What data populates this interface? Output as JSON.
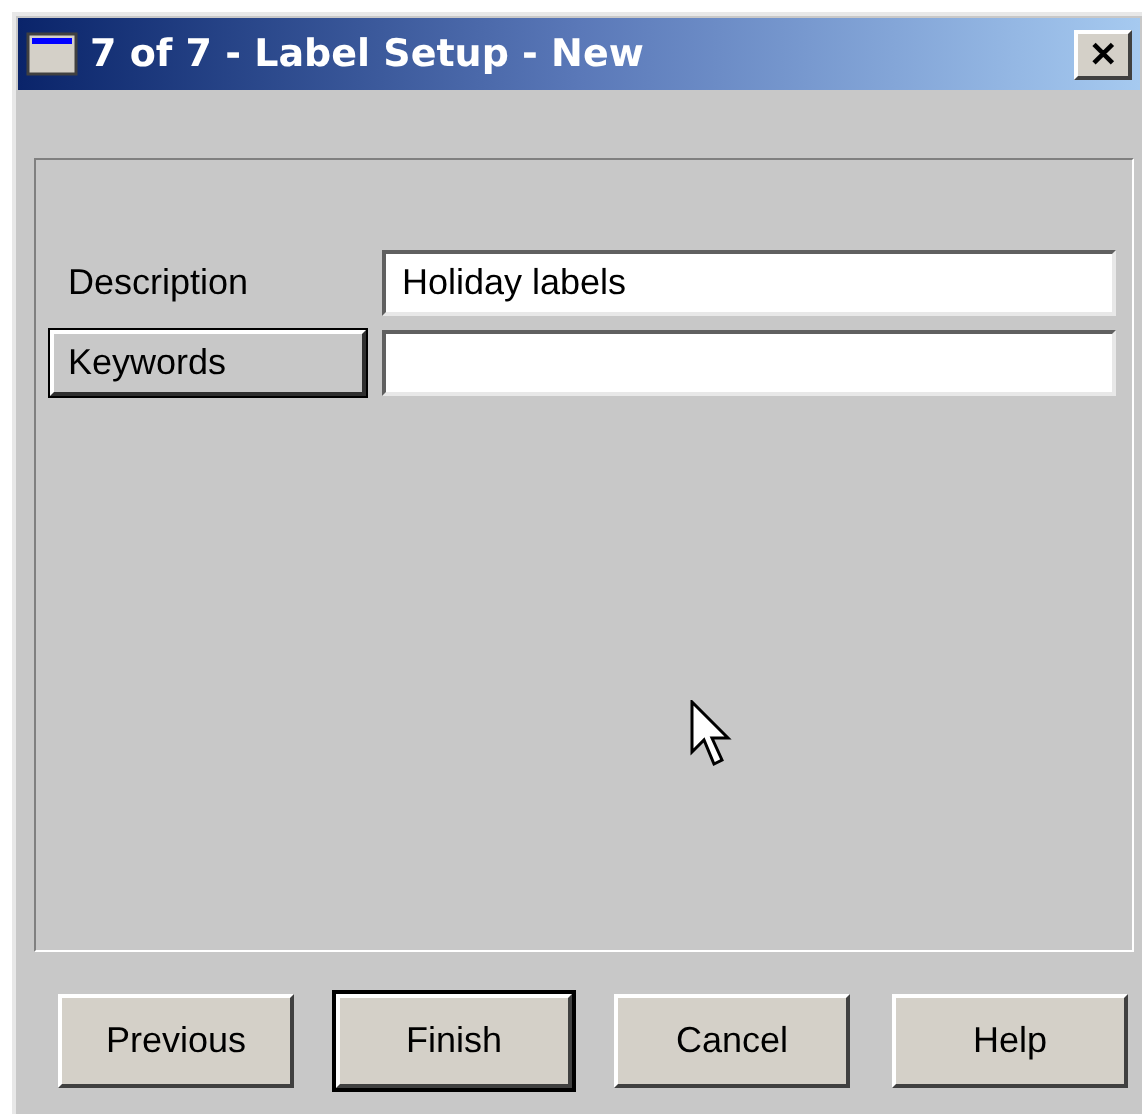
{
  "window": {
    "title": "7 of 7 - Label Setup - New",
    "close": "✕"
  },
  "fields": [
    {
      "kind": "label",
      "label": "Description",
      "value": "Holiday labels"
    },
    {
      "kind": "button",
      "label": "Keywords"
    }
  ],
  "buttons": [
    {
      "label": "Previous",
      "default": false
    },
    {
      "label": "Finish",
      "default": true
    },
    {
      "label": "Cancel",
      "default": false
    },
    {
      "label": "Help",
      "default": false
    }
  ]
}
